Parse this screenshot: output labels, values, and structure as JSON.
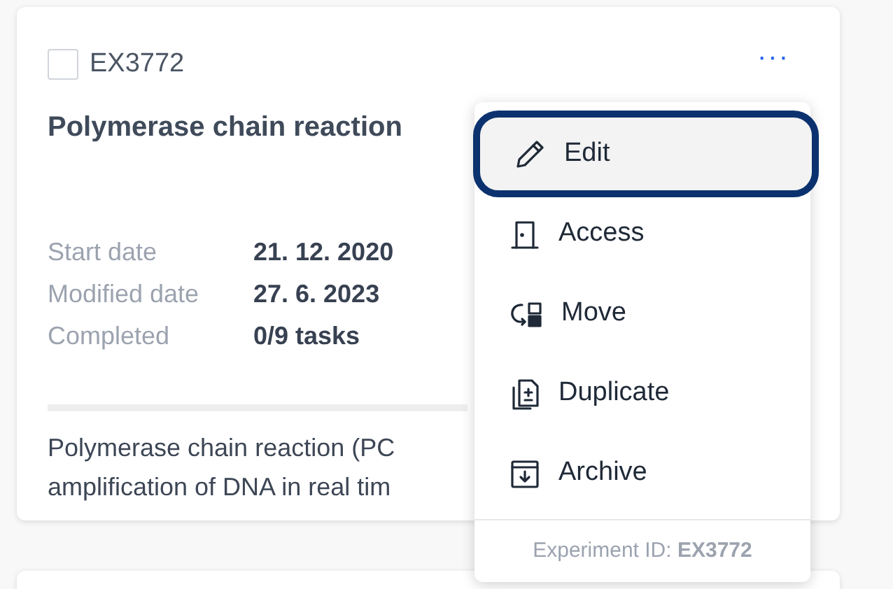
{
  "card": {
    "checkbox": {
      "checked": false
    },
    "id": "EX3772",
    "more": "···",
    "title": "Polymerase chain reaction",
    "details": [
      {
        "label": "Start date",
        "value": "21. 12. 2020"
      },
      {
        "label": "Modified date",
        "value": "27. 6. 2023"
      },
      {
        "label": "Completed",
        "value": "0/9 tasks"
      }
    ],
    "description_lines": [
      "Polymerase chain reaction (PC",
      "amplification of DNA in real tim"
    ]
  },
  "menu": {
    "items": [
      {
        "kind": "edit",
        "label": "Edit",
        "selected": true
      },
      {
        "kind": "access",
        "label": "Access",
        "selected": false
      },
      {
        "kind": "move",
        "label": "Move",
        "selected": false
      },
      {
        "kind": "duplicate",
        "label": "Duplicate",
        "selected": false
      },
      {
        "kind": "archive",
        "label": "Archive",
        "selected": false
      }
    ],
    "footer": "Experiment ID: **EX3772**"
  }
}
